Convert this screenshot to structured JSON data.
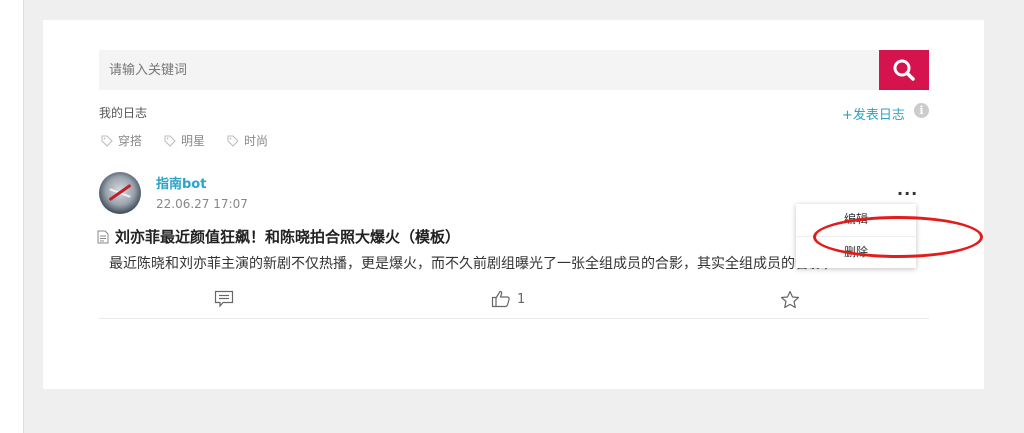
{
  "search": {
    "placeholder": "请输入关键词",
    "button_icon": "search-icon"
  },
  "diary": {
    "title": "我的日志",
    "publish_label": "+发表日志",
    "info_icon": "info-icon"
  },
  "tags": [
    {
      "label": "穿搭"
    },
    {
      "label": "明星"
    },
    {
      "label": "时尚"
    }
  ],
  "post": {
    "author": "指南bot",
    "date": "22.06.27 17:07",
    "title": "刘亦菲最近颜值狂飙！和陈晓拍合照大爆火（模板）",
    "excerpt": "最近陈晓和刘亦菲主演的新剧不仅热播，更是爆火，而不久前剧组曝光了一张全组成员的合影，其实全组成员的合影，",
    "more_label": "···",
    "likes": "1"
  },
  "menu": {
    "edit_label": "编辑",
    "delete_label": "删除"
  },
  "colors": {
    "accent": "#d5144e",
    "link": "#2aa3c9",
    "highlight": "#e21b1b"
  }
}
